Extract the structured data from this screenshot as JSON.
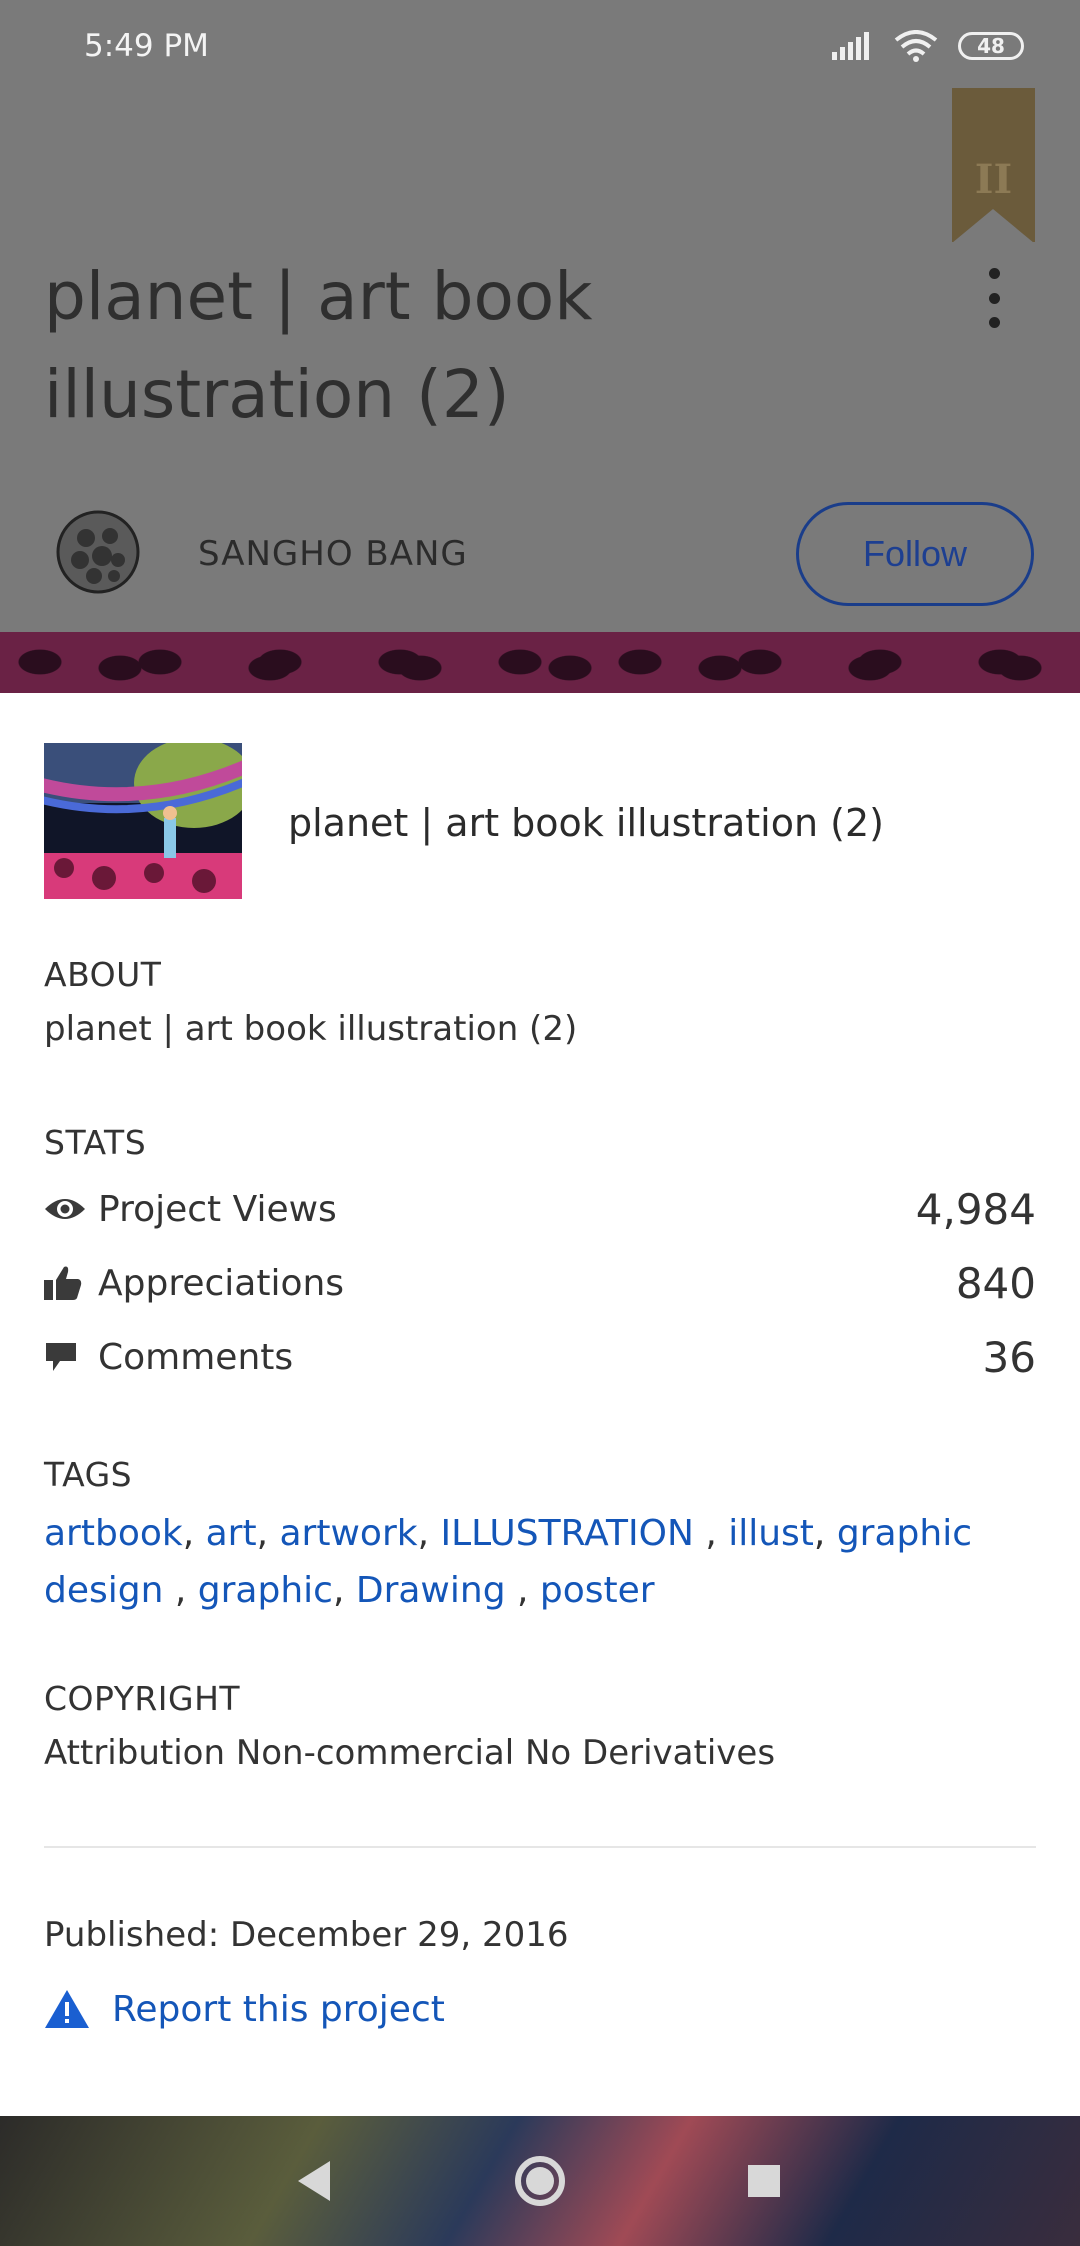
{
  "status_bar": {
    "time": "5:49 PM",
    "battery": "48"
  },
  "background": {
    "bookmark_glyph": "II",
    "project_title": "planet | art book illustration (2)",
    "author_name": "SANGHO BANG",
    "follow_label": "Follow"
  },
  "sheet": {
    "project_title": "planet | art book illustration (2)",
    "about": {
      "label": "ABOUT",
      "text": "planet | art book illustration (2)"
    },
    "stats": {
      "label": "STATS",
      "items": [
        {
          "label": "Project Views",
          "value": "4,984",
          "icon": "eye-icon"
        },
        {
          "label": "Appreciations",
          "value": "840",
          "icon": "thumbs-up-icon"
        },
        {
          "label": "Comments",
          "value": "36",
          "icon": "comment-icon"
        }
      ]
    },
    "tags": {
      "label": "TAGS",
      "items": [
        "artbook",
        "art",
        "artwork",
        "ILLUSTRATION ",
        "illust",
        "graphic design ",
        "graphic",
        "Drawing ",
        "poster"
      ]
    },
    "copyright": {
      "label": "COPYRIGHT",
      "text": "Attribution Non-commercial No Derivatives"
    },
    "published": "Published: December 29, 2016",
    "report_label": "Report this project"
  },
  "colors": {
    "link": "#1456b8",
    "follow_border": "#1a3d8a",
    "warning_icon": "#1a5fd1"
  }
}
